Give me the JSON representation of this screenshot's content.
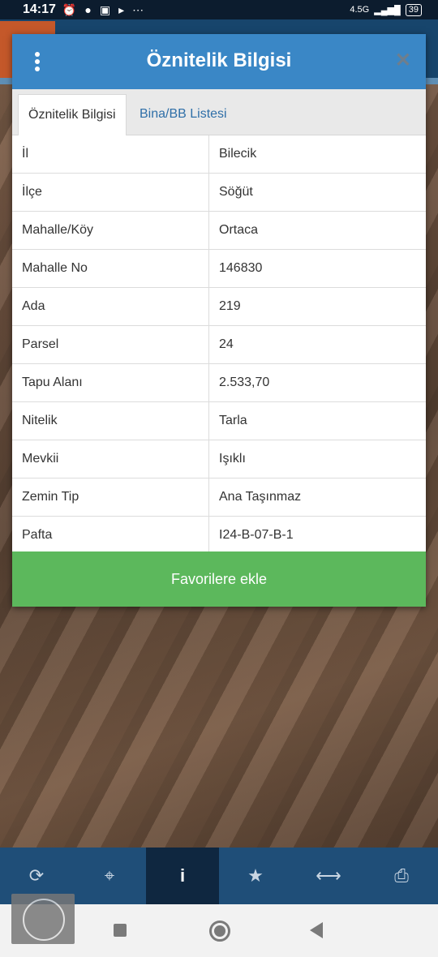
{
  "statusbar": {
    "time": "14:17",
    "network": "4.5G",
    "battery": "39"
  },
  "dialog": {
    "title": "Öznitelik Bilgisi",
    "close_label": "✕",
    "tabs": [
      {
        "label": "Öznitelik Bilgisi",
        "active": true
      },
      {
        "label": "Bina/BB Listesi",
        "active": false
      }
    ],
    "rows": [
      {
        "key": "İl",
        "value": "Bilecik"
      },
      {
        "key": "İlçe",
        "value": "Söğüt"
      },
      {
        "key": "Mahalle/Köy",
        "value": "Ortaca"
      },
      {
        "key": "Mahalle No",
        "value": "146830"
      },
      {
        "key": "Ada",
        "value": "219"
      },
      {
        "key": "Parsel",
        "value": "24"
      },
      {
        "key": "Tapu Alanı",
        "value": "2.533,70"
      },
      {
        "key": "Nitelik",
        "value": "Tarla"
      },
      {
        "key": "Mevkii",
        "value": "Işıklı"
      },
      {
        "key": "Zemin Tip",
        "value": "Ana Taşınmaz"
      },
      {
        "key": "Pafta",
        "value": "I24-B-07-B-1"
      }
    ],
    "favorite_button": "Favorilere ekle"
  },
  "toolbar": {
    "items": [
      {
        "icon": "refresh-icon",
        "glyph": "⟳"
      },
      {
        "icon": "locate-icon",
        "glyph": "⌖"
      },
      {
        "icon": "info-icon",
        "glyph": "i",
        "active": true
      },
      {
        "icon": "star-icon",
        "glyph": "★"
      },
      {
        "icon": "measure-icon",
        "glyph": "⟷"
      },
      {
        "icon": "print-icon",
        "glyph": "⎙"
      }
    ]
  },
  "colors": {
    "header": "#3a87c6",
    "favorite": "#5cb85c",
    "toolbar": "#1f4e78"
  }
}
